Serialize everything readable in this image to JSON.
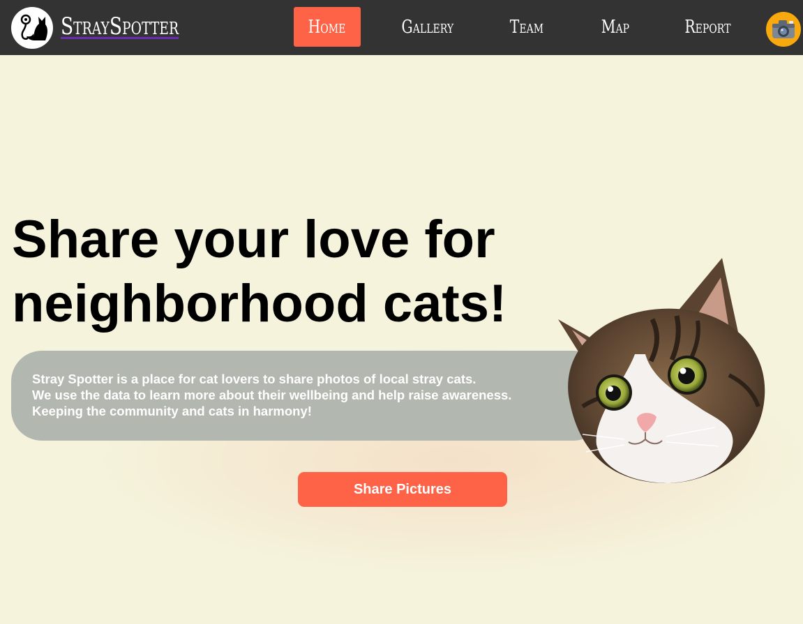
{
  "brand": {
    "name": "StraySpotter",
    "logo_icon": "cat-logo-icon"
  },
  "nav": {
    "items": [
      {
        "label": "Home",
        "active": true
      },
      {
        "label": "Gallery",
        "active": false
      },
      {
        "label": "Team",
        "active": false
      },
      {
        "label": "Map",
        "active": false
      },
      {
        "label": "Report",
        "active": false
      }
    ],
    "camera_icon": "camera-icon"
  },
  "hero": {
    "headline_line1": "Share your love for",
    "headline_line2": "neighborhood cats!",
    "description": [
      "Stray Spotter is a place for cat lovers to share photos of local stray cats.",
      "We use the data to learn more about their wellbeing and help raise awareness.",
      "Keeping the community and cats in harmony!"
    ],
    "cta_label": "Share Pictures"
  },
  "colors": {
    "navbar": "#333333",
    "background": "#f5f3dc",
    "accent": "#ff6347",
    "info_box": "#b2b8b0",
    "camera_button": "#f7a90d"
  }
}
